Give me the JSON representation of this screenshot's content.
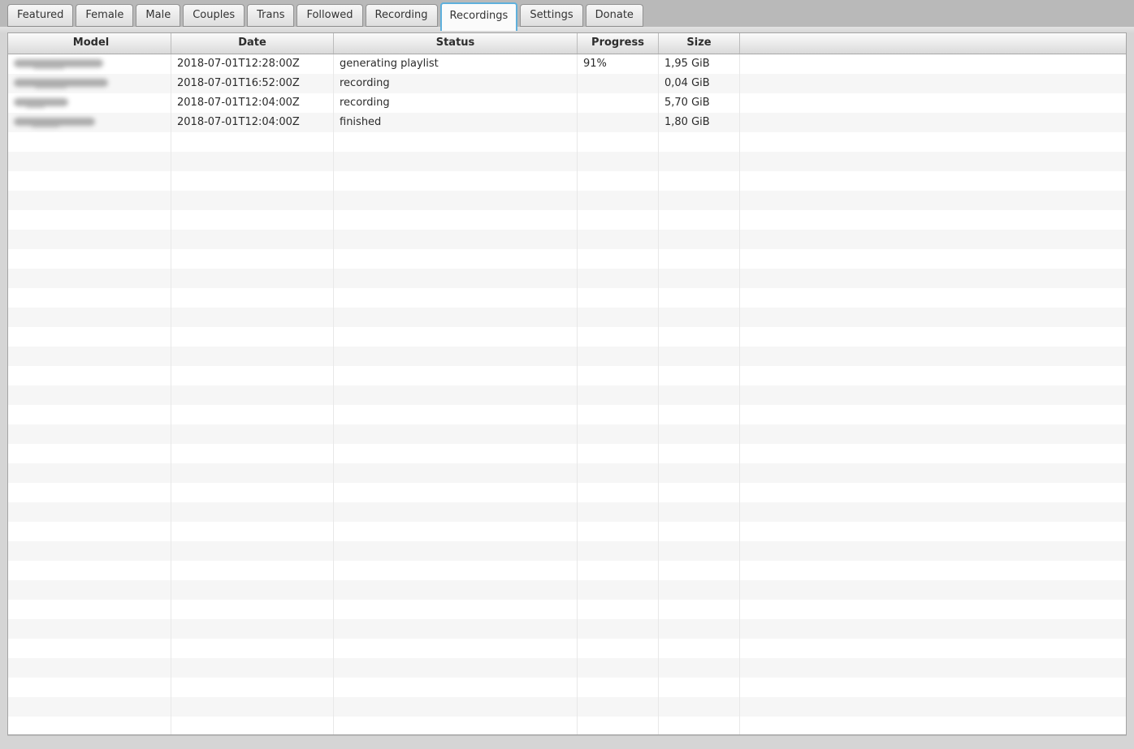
{
  "tabs": [
    {
      "label": "Featured",
      "active": false
    },
    {
      "label": "Female",
      "active": false
    },
    {
      "label": "Male",
      "active": false
    },
    {
      "label": "Couples",
      "active": false
    },
    {
      "label": "Trans",
      "active": false
    },
    {
      "label": "Followed",
      "active": false
    },
    {
      "label": "Recording",
      "active": false
    },
    {
      "label": "Recordings",
      "active": true
    },
    {
      "label": "Settings",
      "active": false
    },
    {
      "label": "Donate",
      "active": false
    }
  ],
  "table": {
    "columns": [
      "Model",
      "Date",
      "Status",
      "Progress",
      "Size",
      ""
    ],
    "rows": [
      {
        "model_redacted": true,
        "model_blur_width": 110,
        "date": "2018-07-01T12:28:00Z",
        "status": "generating playlist",
        "progress": "91%",
        "size": "1,95 GiB"
      },
      {
        "model_redacted": true,
        "model_blur_width": 116,
        "date": "2018-07-01T16:52:00Z",
        "status": "recording",
        "progress": "",
        "size": "0,04 GiB"
      },
      {
        "model_redacted": true,
        "model_blur_width": 67,
        "date": "2018-07-01T12:04:00Z",
        "status": "recording",
        "progress": "",
        "size": "5,70 GiB"
      },
      {
        "model_redacted": true,
        "model_blur_width": 100,
        "date": "2018-07-01T12:04:00Z",
        "status": "finished",
        "progress": "",
        "size": "1,80 GiB"
      }
    ],
    "empty_row_count": 31
  },
  "colors": {
    "active_tab_border": "#5fb0dc",
    "tabbar_background": "#b9b9b9",
    "content_background": "#d5d5d5",
    "row_stripe": "#f6f6f6",
    "table_border": "#a4a4a4"
  }
}
